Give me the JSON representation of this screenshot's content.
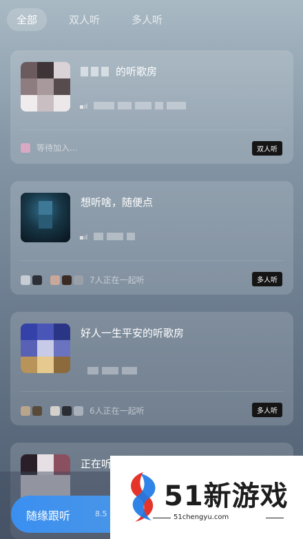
{
  "tabs": [
    {
      "label": "全部",
      "active": true
    },
    {
      "label": "双人听",
      "active": false
    },
    {
      "label": "多人听",
      "active": false
    }
  ],
  "rooms": [
    {
      "title": "的听歌房",
      "status": "等待加入...",
      "badge": "双人听"
    },
    {
      "title": "想听啥，随便点",
      "status": "7人正在一起听",
      "badge": "多人听"
    },
    {
      "title": "好人一生平安的听歌房",
      "status": "6人正在一起听",
      "badge": "多人听"
    },
    {
      "title": "正在听"
    }
  ],
  "follow_button": {
    "label": "随缘跟听",
    "hint": "8.5"
  },
  "watermark": {
    "logo_text": "51新游戏",
    "domain": "51chengyu.com"
  },
  "colors": {
    "badge_bg": "#151515",
    "button_blue": "#3a8ff0",
    "watermark_blue": "#1e7ae6",
    "watermark_red": "#e5352b"
  }
}
